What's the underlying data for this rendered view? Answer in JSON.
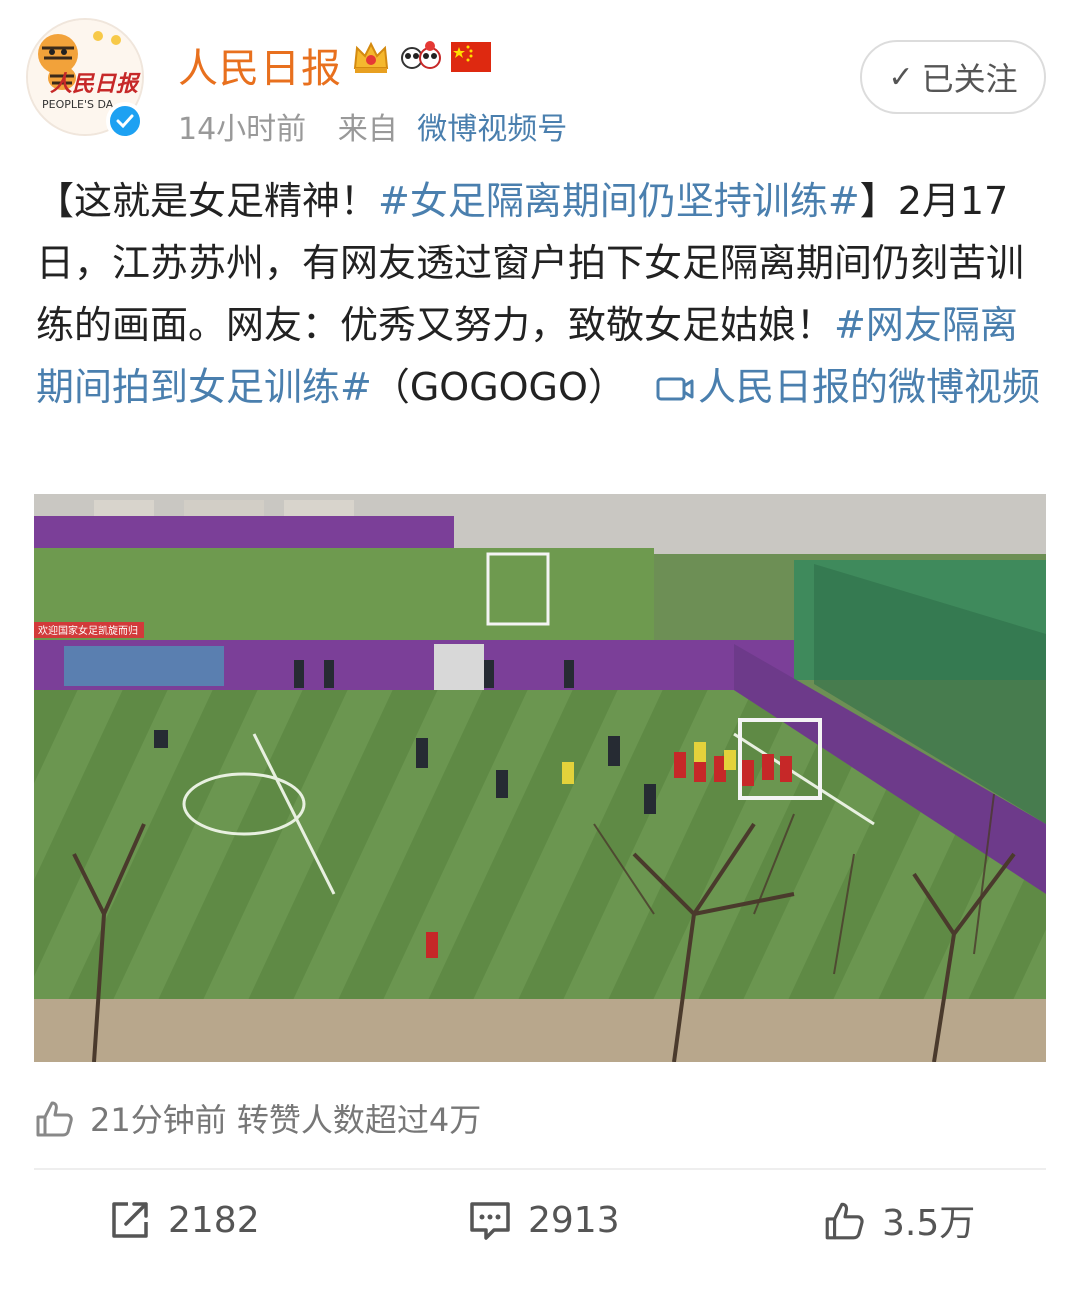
{
  "post": {
    "user_name": "人民日报",
    "time": "14小时前",
    "from_label": "来自",
    "source": "微博视频号",
    "follow_label": "已关注",
    "avatar_brand": "人民日报",
    "avatar_brand_en": "PEOPLE'S DA",
    "text_parts": {
      "bracket_open": "【这就是女足精神！",
      "tag1": "#女足隔离期间仍坚持训练#",
      "body": "】2月17日，江苏苏州，有网友透过窗户拍下女足隔离期间仍刻苦训练的画面。网友：优秀又努力，致敬女足姑娘！",
      "tag2": "#网友隔离期间拍到女足训练#",
      "paren": "（GOGOGO）",
      "video_link": "人民日报的微博视频"
    },
    "video_banner": "欢迎国家女足凯旋而归"
  },
  "activity": {
    "text": "21分钟前 转赞人数超过4万"
  },
  "actions": {
    "repost_count": "2182",
    "comment_count": "2913",
    "like_count": "3.5万"
  },
  "icons": [
    "verified-icon",
    "crown-badge-icon",
    "panda-badge-icon",
    "flag-badge-icon",
    "check-icon",
    "video-icon",
    "like-icon",
    "repost-icon",
    "comment-icon"
  ],
  "colors": {
    "user_name": "#e8701e",
    "link": "#4a7fae",
    "verified": "#1da1f2",
    "meta": "#999999"
  }
}
